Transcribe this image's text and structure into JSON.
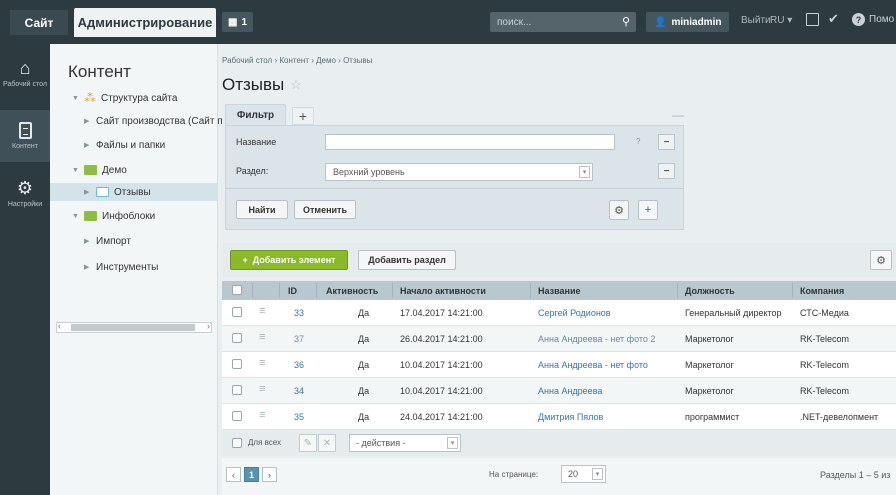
{
  "topbar": {
    "site": "Сайт",
    "admin": "Администрирование",
    "notif_count": "1",
    "search_placeholder": "поиск...",
    "user": "miniadmin",
    "exit": "Выйти",
    "lang": "RU",
    "help": "Помо"
  },
  "iconbar": {
    "desktop": "Рабочий стол",
    "content": "Контент",
    "settings": "Настройки"
  },
  "tree": {
    "title": "Контент",
    "items": [
      "Структура сайта",
      "Сайт производства (Сайт п",
      "Файлы и папки",
      "Демо",
      "Отзывы",
      "Инфоблоки",
      "Импорт",
      "Инструменты"
    ]
  },
  "breadcrumbs": [
    "Рабочий стол",
    "Контент",
    "Демо",
    "Отзывы"
  ],
  "page_title": "Отзывы",
  "filter": {
    "tab": "Фильтр",
    "name_label": "Название",
    "name_value": "",
    "section_label": "Раздел:",
    "section_value": "Верхний уровень",
    "find": "Найти",
    "cancel": "Отменить"
  },
  "toolbar": {
    "add_element": "Добавить элемент",
    "add_section": "Добавить раздел"
  },
  "grid": {
    "columns": [
      "ID",
      "Активность",
      "Начало активности",
      "Название",
      "Должность",
      "Компания"
    ],
    "rows": [
      {
        "id": "33",
        "active": "Да",
        "start": "17.04.2017 14:21:00",
        "name": "Сергей Родионов",
        "position": "Генеральный директор",
        "company": "СТС-Медиа"
      },
      {
        "id": "37",
        "active": "Да",
        "start": "26.04.2017 14:21:00",
        "name": "Анна Андреева - нет фото 2",
        "position": "Маркетолог",
        "company": "RK-Telecom"
      },
      {
        "id": "36",
        "active": "Да",
        "start": "10.04.2017 14:21:00",
        "name": "Анна Андреева - нет фото",
        "position": "Маркетолог",
        "company": "RK-Telecom"
      },
      {
        "id": "34",
        "active": "Да",
        "start": "10.04.2017 14:21:00",
        "name": "Анна Андреева",
        "position": "Маркетолог",
        "company": "RK-Telecom"
      },
      {
        "id": "35",
        "active": "Да",
        "start": "24.04.2017 14:21:00",
        "name": "Дмитрия Пялов",
        "position": "программист",
        "company": ".NET-девелопмент"
      }
    ]
  },
  "footer": {
    "for_all": "Для всех",
    "actions": "- действия -"
  },
  "pager": {
    "current": "1",
    "per_page_label": "На странице:",
    "per_page": "20",
    "range": "Разделы 1 – 5 из"
  }
}
